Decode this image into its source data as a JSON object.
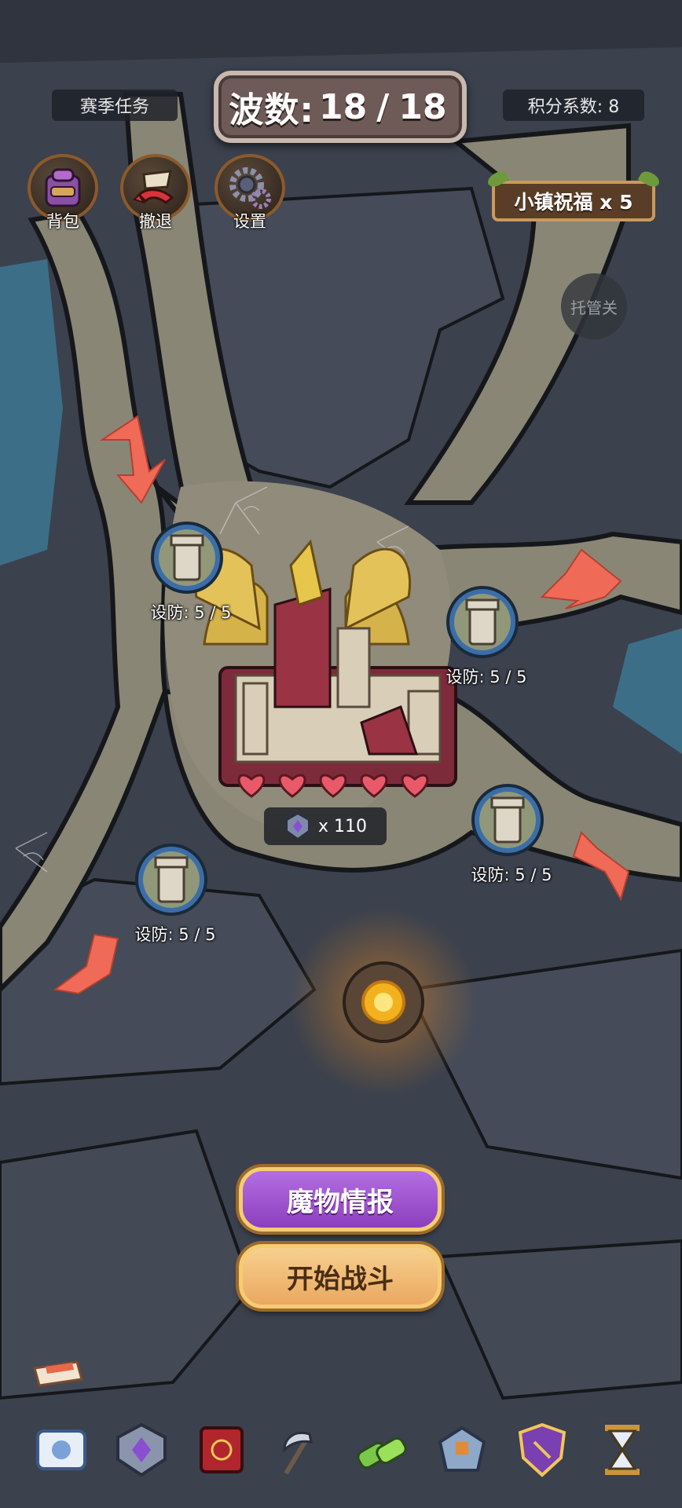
{
  "top_bar": {
    "season_task": "赛季任务",
    "wave_label": "波数:",
    "wave_current": "18",
    "wave_total": "18",
    "score_coefficient": "积分系数: 8"
  },
  "controls": {
    "bag": "背包",
    "retreat": "撤退",
    "settings": "设置",
    "auto_manage": "托管关"
  },
  "blessing": "小镇祝福 x 5",
  "towers": [
    {
      "defense": "设防: 5 / 5"
    },
    {
      "defense": "设防: 5 / 5"
    },
    {
      "defense": "设防: 5 / 5"
    },
    {
      "defense": "设防: 5 / 5"
    }
  ],
  "base": {
    "hearts": 5,
    "count": "x 110"
  },
  "buttons": {
    "monster_info": "魔物情报",
    "start_battle": "开始战斗"
  },
  "colors": {
    "path": "#8a8676",
    "rock": "#3d4350",
    "water": "#3d6e88",
    "arrow": "#f06a58",
    "heart": "#e85a6a"
  },
  "bottom_icons": [
    "scroll-icon",
    "rank-badge-icon",
    "spellbook-icon",
    "scythe-icon",
    "potion-icon",
    "rune-stone-icon",
    "shield-icon",
    "hourglass-icon"
  ]
}
